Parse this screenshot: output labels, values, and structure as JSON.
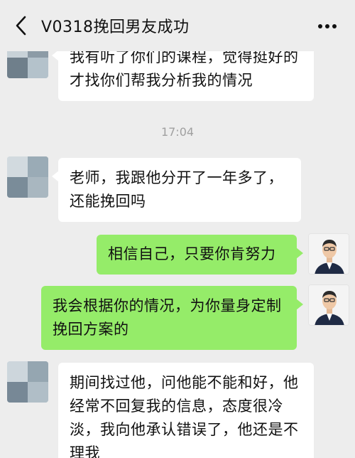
{
  "header": {
    "title": "V0318挽回男友成功",
    "back_icon": "chevron-left-icon",
    "more_icon": "more-dots-icon"
  },
  "timestamp": "17:04",
  "messages": [
    {
      "side": "left",
      "text": "我有听了你们的课程，觉得挺好的才找你们帮我分析我的情况"
    },
    {
      "side": "left",
      "text": "老师，我跟他分开了一年多了，还能挽回吗"
    },
    {
      "side": "right",
      "text": "相信自己，只要你肯努力"
    },
    {
      "side": "right",
      "text": "我会根据你的情况，为你量身定制挽回方案的"
    },
    {
      "side": "left",
      "text": "期间找过他，问他能不能和好，他经常不回复我的信息，态度很冷淡，我向他承认错误了，他还是不理我"
    }
  ],
  "colors": {
    "background": "#ededed",
    "incoming_bubble": "#ffffff",
    "outgoing_bubble": "#95ec69"
  }
}
